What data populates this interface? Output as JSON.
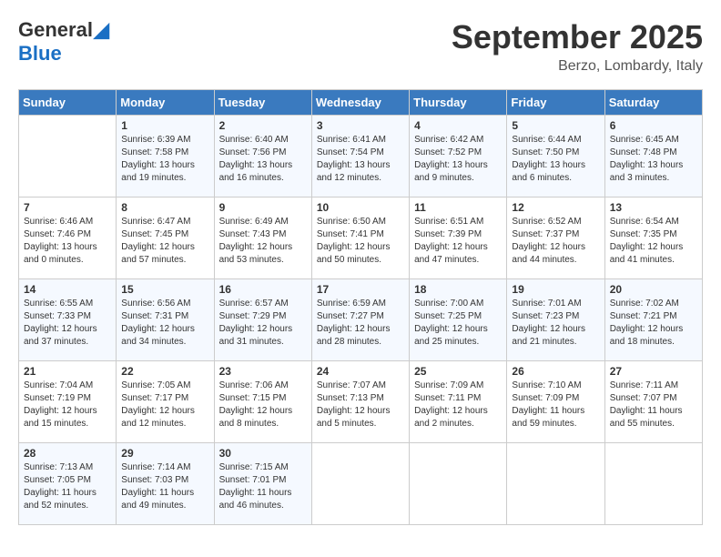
{
  "logo": {
    "general": "General",
    "blue": "Blue"
  },
  "title": "September 2025",
  "location": "Berzo, Lombardy, Italy",
  "days_header": [
    "Sunday",
    "Monday",
    "Tuesday",
    "Wednesday",
    "Thursday",
    "Friday",
    "Saturday"
  ],
  "weeks": [
    [
      {
        "num": "",
        "sunrise": "",
        "sunset": "",
        "daylight": ""
      },
      {
        "num": "1",
        "sunrise": "Sunrise: 6:39 AM",
        "sunset": "Sunset: 7:58 PM",
        "daylight": "Daylight: 13 hours and 19 minutes."
      },
      {
        "num": "2",
        "sunrise": "Sunrise: 6:40 AM",
        "sunset": "Sunset: 7:56 PM",
        "daylight": "Daylight: 13 hours and 16 minutes."
      },
      {
        "num": "3",
        "sunrise": "Sunrise: 6:41 AM",
        "sunset": "Sunset: 7:54 PM",
        "daylight": "Daylight: 13 hours and 12 minutes."
      },
      {
        "num": "4",
        "sunrise": "Sunrise: 6:42 AM",
        "sunset": "Sunset: 7:52 PM",
        "daylight": "Daylight: 13 hours and 9 minutes."
      },
      {
        "num": "5",
        "sunrise": "Sunrise: 6:44 AM",
        "sunset": "Sunset: 7:50 PM",
        "daylight": "Daylight: 13 hours and 6 minutes."
      },
      {
        "num": "6",
        "sunrise": "Sunrise: 6:45 AM",
        "sunset": "Sunset: 7:48 PM",
        "daylight": "Daylight: 13 hours and 3 minutes."
      }
    ],
    [
      {
        "num": "7",
        "sunrise": "Sunrise: 6:46 AM",
        "sunset": "Sunset: 7:46 PM",
        "daylight": "Daylight: 13 hours and 0 minutes."
      },
      {
        "num": "8",
        "sunrise": "Sunrise: 6:47 AM",
        "sunset": "Sunset: 7:45 PM",
        "daylight": "Daylight: 12 hours and 57 minutes."
      },
      {
        "num": "9",
        "sunrise": "Sunrise: 6:49 AM",
        "sunset": "Sunset: 7:43 PM",
        "daylight": "Daylight: 12 hours and 53 minutes."
      },
      {
        "num": "10",
        "sunrise": "Sunrise: 6:50 AM",
        "sunset": "Sunset: 7:41 PM",
        "daylight": "Daylight: 12 hours and 50 minutes."
      },
      {
        "num": "11",
        "sunrise": "Sunrise: 6:51 AM",
        "sunset": "Sunset: 7:39 PM",
        "daylight": "Daylight: 12 hours and 47 minutes."
      },
      {
        "num": "12",
        "sunrise": "Sunrise: 6:52 AM",
        "sunset": "Sunset: 7:37 PM",
        "daylight": "Daylight: 12 hours and 44 minutes."
      },
      {
        "num": "13",
        "sunrise": "Sunrise: 6:54 AM",
        "sunset": "Sunset: 7:35 PM",
        "daylight": "Daylight: 12 hours and 41 minutes."
      }
    ],
    [
      {
        "num": "14",
        "sunrise": "Sunrise: 6:55 AM",
        "sunset": "Sunset: 7:33 PM",
        "daylight": "Daylight: 12 hours and 37 minutes."
      },
      {
        "num": "15",
        "sunrise": "Sunrise: 6:56 AM",
        "sunset": "Sunset: 7:31 PM",
        "daylight": "Daylight: 12 hours and 34 minutes."
      },
      {
        "num": "16",
        "sunrise": "Sunrise: 6:57 AM",
        "sunset": "Sunset: 7:29 PM",
        "daylight": "Daylight: 12 hours and 31 minutes."
      },
      {
        "num": "17",
        "sunrise": "Sunrise: 6:59 AM",
        "sunset": "Sunset: 7:27 PM",
        "daylight": "Daylight: 12 hours and 28 minutes."
      },
      {
        "num": "18",
        "sunrise": "Sunrise: 7:00 AM",
        "sunset": "Sunset: 7:25 PM",
        "daylight": "Daylight: 12 hours and 25 minutes."
      },
      {
        "num": "19",
        "sunrise": "Sunrise: 7:01 AM",
        "sunset": "Sunset: 7:23 PM",
        "daylight": "Daylight: 12 hours and 21 minutes."
      },
      {
        "num": "20",
        "sunrise": "Sunrise: 7:02 AM",
        "sunset": "Sunset: 7:21 PM",
        "daylight": "Daylight: 12 hours and 18 minutes."
      }
    ],
    [
      {
        "num": "21",
        "sunrise": "Sunrise: 7:04 AM",
        "sunset": "Sunset: 7:19 PM",
        "daylight": "Daylight: 12 hours and 15 minutes."
      },
      {
        "num": "22",
        "sunrise": "Sunrise: 7:05 AM",
        "sunset": "Sunset: 7:17 PM",
        "daylight": "Daylight: 12 hours and 12 minutes."
      },
      {
        "num": "23",
        "sunrise": "Sunrise: 7:06 AM",
        "sunset": "Sunset: 7:15 PM",
        "daylight": "Daylight: 12 hours and 8 minutes."
      },
      {
        "num": "24",
        "sunrise": "Sunrise: 7:07 AM",
        "sunset": "Sunset: 7:13 PM",
        "daylight": "Daylight: 12 hours and 5 minutes."
      },
      {
        "num": "25",
        "sunrise": "Sunrise: 7:09 AM",
        "sunset": "Sunset: 7:11 PM",
        "daylight": "Daylight: 12 hours and 2 minutes."
      },
      {
        "num": "26",
        "sunrise": "Sunrise: 7:10 AM",
        "sunset": "Sunset: 7:09 PM",
        "daylight": "Daylight: 11 hours and 59 minutes."
      },
      {
        "num": "27",
        "sunrise": "Sunrise: 7:11 AM",
        "sunset": "Sunset: 7:07 PM",
        "daylight": "Daylight: 11 hours and 55 minutes."
      }
    ],
    [
      {
        "num": "28",
        "sunrise": "Sunrise: 7:13 AM",
        "sunset": "Sunset: 7:05 PM",
        "daylight": "Daylight: 11 hours and 52 minutes."
      },
      {
        "num": "29",
        "sunrise": "Sunrise: 7:14 AM",
        "sunset": "Sunset: 7:03 PM",
        "daylight": "Daylight: 11 hours and 49 minutes."
      },
      {
        "num": "30",
        "sunrise": "Sunrise: 7:15 AM",
        "sunset": "Sunset: 7:01 PM",
        "daylight": "Daylight: 11 hours and 46 minutes."
      },
      {
        "num": "",
        "sunrise": "",
        "sunset": "",
        "daylight": ""
      },
      {
        "num": "",
        "sunrise": "",
        "sunset": "",
        "daylight": ""
      },
      {
        "num": "",
        "sunrise": "",
        "sunset": "",
        "daylight": ""
      },
      {
        "num": "",
        "sunrise": "",
        "sunset": "",
        "daylight": ""
      }
    ]
  ]
}
